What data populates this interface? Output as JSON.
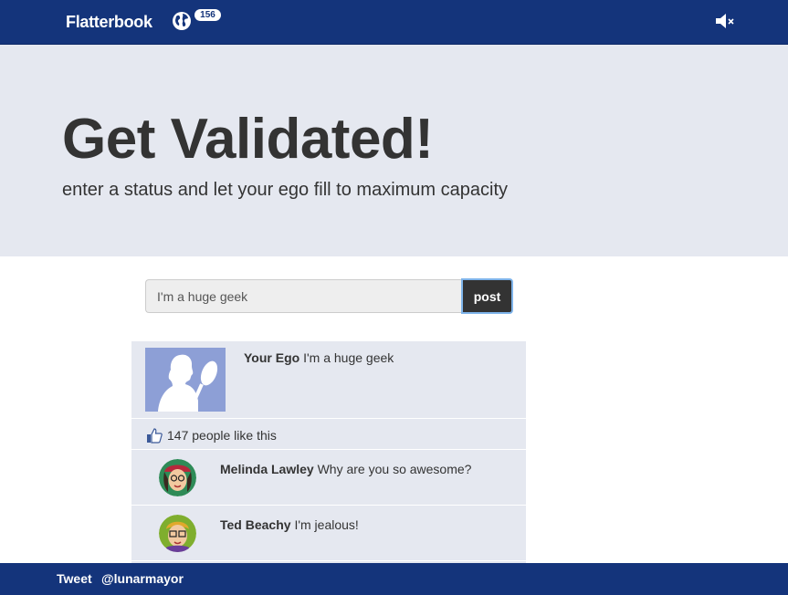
{
  "header": {
    "brand": "Flatterbook",
    "notification_count": "156",
    "icons": [
      "globe-icon",
      "mute-icon"
    ]
  },
  "hero": {
    "title": "Get Validated!",
    "subtitle": "enter a status and let your ego fill to maximum capacity"
  },
  "composer": {
    "value": "I'm a huge geek",
    "post_label": "post"
  },
  "feed": {
    "post": {
      "author": "Your Ego",
      "text": "I'm a huge geek"
    },
    "likes": "147 people like this",
    "comments": [
      {
        "author": "Melinda Lawley",
        "text": "Why are you so awesome?"
      },
      {
        "author": "Ted Beachy",
        "text": "I'm jealous!"
      }
    ]
  },
  "footer": {
    "tweet": "Tweet",
    "handle": "@lunarmayor"
  },
  "colors": {
    "navbar": "#14347b",
    "hero_bg": "#e5e8f0",
    "post_button": "#333333",
    "avatar_bg": "#8d9fd6"
  }
}
